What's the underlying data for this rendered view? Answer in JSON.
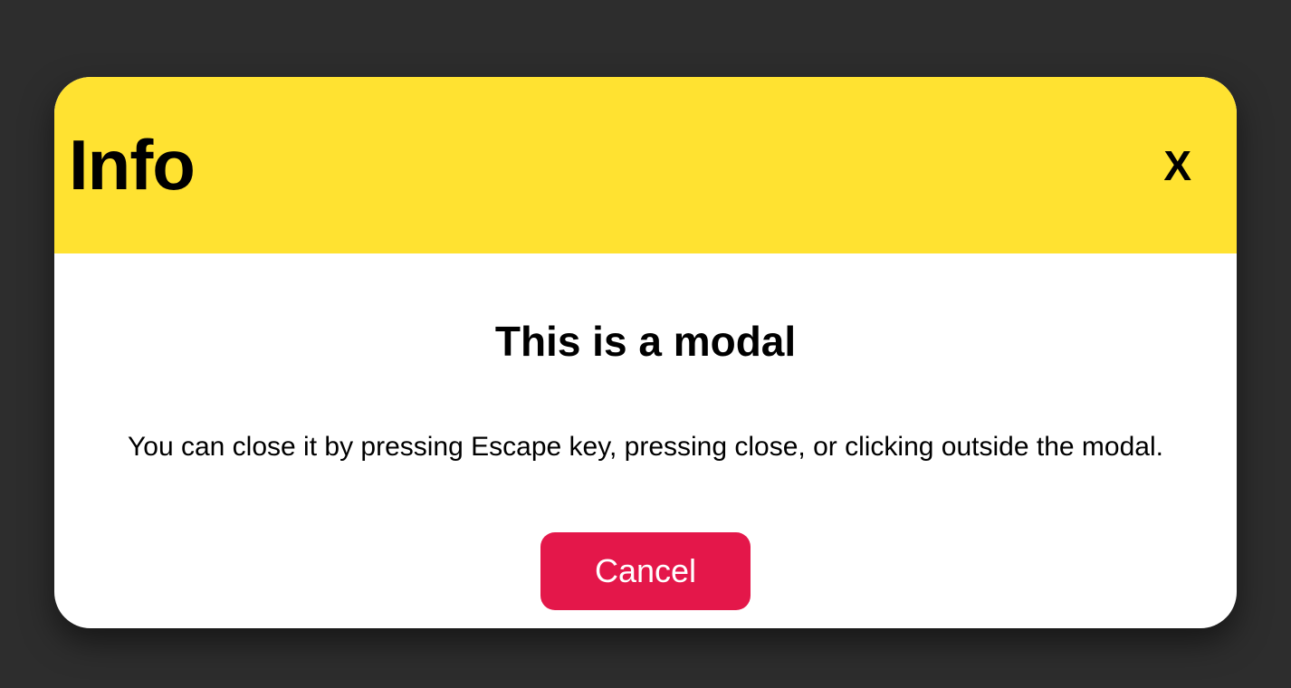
{
  "modal": {
    "title": "Info",
    "close_label": "X",
    "heading": "This is a modal",
    "body_text": "You can close it by pressing Escape key, pressing close, or clicking outside the modal.",
    "cancel_label": "Cancel"
  }
}
